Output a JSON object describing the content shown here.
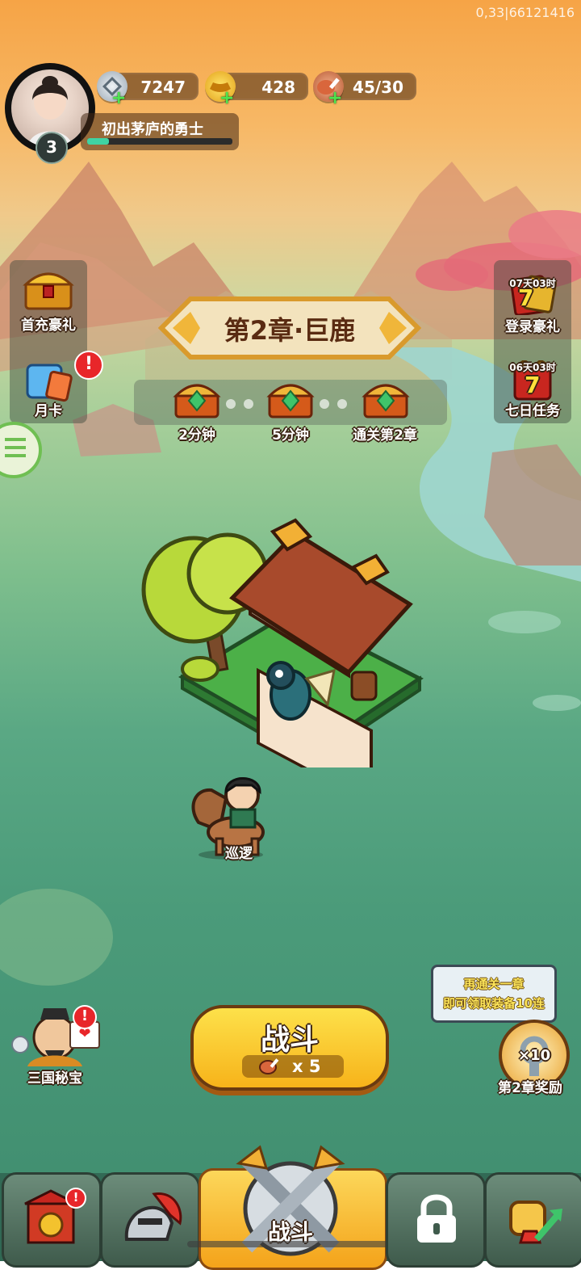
{
  "debug_id": "0,33|66121416",
  "player": {
    "level": "3",
    "title": "初出茅庐的勇士"
  },
  "resources": [
    {
      "name": "silver",
      "icon": "silver-coin-icon",
      "value": "7247"
    },
    {
      "name": "gold",
      "icon": "gold-ingot-icon",
      "value": "428"
    },
    {
      "name": "stamina",
      "icon": "meat-icon",
      "value": "45/30"
    }
  ],
  "left_menu": {
    "first_recharge": "首充豪礼",
    "monthly_card": "月卡"
  },
  "right_menu": {
    "login_gift": {
      "timer": "07天03时",
      "label": "登录豪礼",
      "badge": "7"
    },
    "seven_day": {
      "timer": "06天03时",
      "label": "七日任务",
      "badge": "7"
    }
  },
  "chapter": {
    "title": "第2章·巨鹿"
  },
  "rewards": [
    {
      "label": "2分钟"
    },
    {
      "label": "5分钟"
    },
    {
      "label": "通关第2章"
    }
  ],
  "patrol": {
    "label": "巡逻"
  },
  "treasure": {
    "label": "三国秘宝"
  },
  "tooltip": {
    "line1": "再通关一章",
    "line2": "即可领取装备10连"
  },
  "chapter_reward": {
    "label": "第2章奖励",
    "count": "×10"
  },
  "battle": {
    "label": "战斗",
    "cost": "x 5"
  },
  "bottom_nav": {
    "battle_label": "战斗"
  },
  "colors": {
    "accent_yellow": "#f7c21b",
    "badge_red": "#e8262a"
  }
}
